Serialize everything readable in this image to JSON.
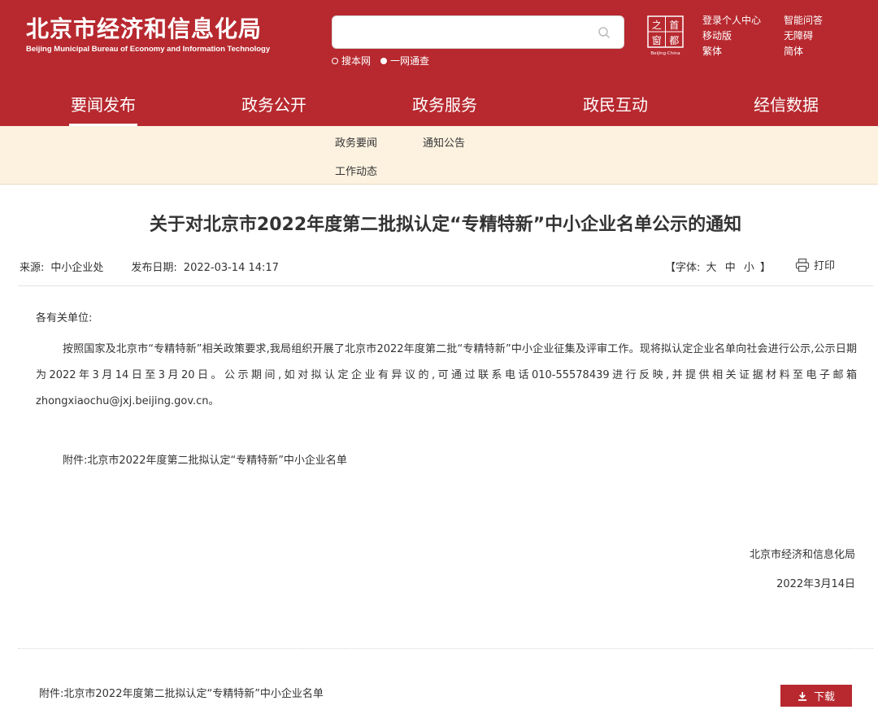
{
  "header": {
    "title_cn": "北京市经济和信息化局",
    "title_en": "Beijing Municipal Bureau of Economy and Information Technology",
    "search": {
      "placeholder": "",
      "icon": "search-icon"
    },
    "search_scope": [
      {
        "label": "搜本网",
        "selected": false
      },
      {
        "label": "一网通查",
        "selected": true
      }
    ],
    "seal": {
      "chars": [
        "首",
        "都",
        "之",
        "窗"
      ],
      "caption": "Beijing·China"
    },
    "links": [
      "登录个人中心",
      "智能问答",
      "移动版",
      "无障碍",
      "繁体",
      "简体"
    ]
  },
  "nav": {
    "items": [
      "要闻发布",
      "政务公开",
      "政务服务",
      "政民互动",
      "经信数据"
    ],
    "active_index": 0
  },
  "subnav": {
    "items": [
      "政务要闻",
      "通知公告",
      "工作动态"
    ]
  },
  "article": {
    "title": "关于对北京市2022年度第二批拟认定“专精特新”中小企业名单公示的通知",
    "source_label": "来源:",
    "source": "中小企业处",
    "date_label": "发布日期:",
    "date": "2022-03-14 14:17",
    "font_label": "【字体:",
    "font_sizes": [
      "大",
      "中",
      "小"
    ],
    "font_close": "】",
    "print_label": "打印",
    "salutation": "各有关单位:",
    "body": "按照国家及北京市“专精特新”相关政策要求,我局组织开展了北京市2022年度第二批“专精特新”中小企业征集及评审工作。现将拟认定企业名单向社会进行公示,公示日期为2022年3月14日至3月20日。公示期间,如对拟认定企业有异议的,可通过联系电话010-55578439进行反映,并提供相关证据材料至电子邮箱zhongxiaochu@jxj.beijing.gov.cn。",
    "attachment_text": "附件:北京市2022年度第二批拟认定“专精特新”中小企业名单",
    "signature_org": "北京市经济和信息化局",
    "signature_date": "2022年3月14日"
  },
  "attachment": {
    "label": "附件:北京市2022年度第二批拟认定“专精特新”中小企业名单",
    "download_label": "下载"
  },
  "colors": {
    "brand_red": "#b7292f",
    "subnav_bg": "#fdf2e0",
    "text": "#333333"
  }
}
